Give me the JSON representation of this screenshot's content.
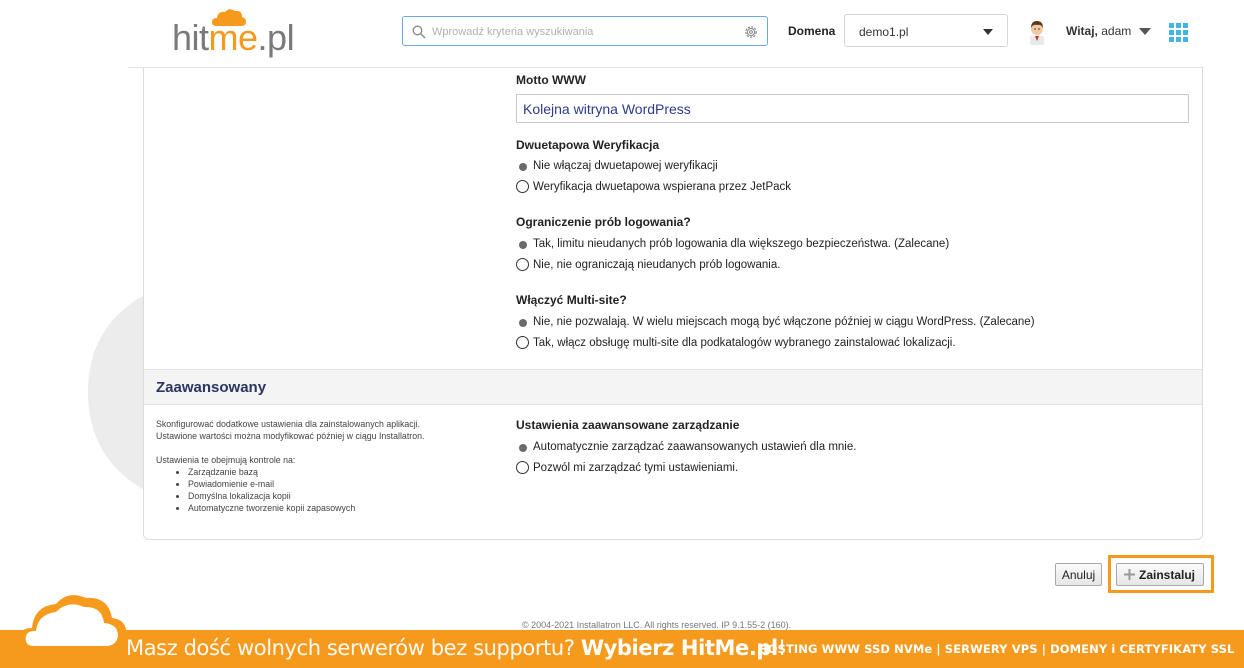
{
  "header": {
    "logo": {
      "part1": "hit",
      "part2": "me",
      "part3": ".pl"
    },
    "search": {
      "placeholder": "Wprowadź kryteria wyszukiwania"
    },
    "domain_label": "Domena",
    "domain_value": "demo1.pl",
    "greeting_bold": "Witaj,",
    "greeting_user": "adam"
  },
  "form": {
    "motto_title": "Motto WWW",
    "motto_value": "Kolejna witryna WordPress",
    "twofa": {
      "title": "Dwuetapowa Weryfikacja",
      "options": [
        "Nie włączaj dwuetapowej weryfikacji",
        "Weryfikacja dwuetapowa wspierana przez JetPack"
      ],
      "selected": 0
    },
    "login_limit": {
      "title": "Ograniczenie prób logowania?",
      "options": [
        "Tak, limitu nieudanych prób logowania dla większego bezpieczeństwa. (Zalecane)",
        "Nie, nie ograniczają nieudanych prób logowania."
      ],
      "selected": 0
    },
    "multisite": {
      "title": "Włączyć Multi-site?",
      "options": [
        "Nie, nie pozwalają. W wielu miejscach mogą być włączone później w ciągu WordPress. (Zalecane)",
        "Tak, włącz obsługę multi-site dla podkatalogów wybranego zainstalować lokalizacji."
      ],
      "selected": 0
    }
  },
  "advanced": {
    "section_title": "Zaawansowany",
    "desc_line1": "Skonfigurować dodatkowe ustawienia dla zainstalowanych aplikacji.",
    "desc_line2": "Ustawione wartości można modyfikować później w ciągu Installatron.",
    "desc_line3": "Ustawienia te obejmują kontrole na:",
    "desc_items": [
      "Zarządzanie bazą",
      "Powiadomienie e-mail",
      "Domyślna lokalizacja kopii",
      "Automatyczne tworzenie kopii zapasowych"
    ],
    "mgmt_title": "Ustawienia zaawansowane zarządzanie",
    "mgmt_options": [
      "Automatycznie zarządzać zaawansowanych ustawień dla mnie.",
      "Pozwól mi zarządzać tymi ustawieniami."
    ],
    "mgmt_selected": 0
  },
  "buttons": {
    "cancel": "Anuluj",
    "install": "Zainstaluj"
  },
  "footer": {
    "copyright": "© 2004-2021 Installatron LLC. All rights reserved. IP 9.1.55-2 (160)."
  },
  "banner": {
    "text_light": "Masz dość wolnych serwerów bez supportu?",
    "text_bold": "Wybierz HitMe.pl",
    "text_end": "!",
    "right": "HOSTING WWW SSD NVMe | SERWERY VPS | DOMENY i CERTYFIKATY SSL"
  },
  "colors": {
    "brand_orange": "#f59a1d",
    "search_border": "#6aa8e6",
    "section_title": "#2a3560",
    "input_text": "#2d3a8c"
  },
  "icons": [
    "search-icon",
    "gear-icon",
    "avatar",
    "apps-grid-icon",
    "plus-icon",
    "cloud-logo"
  ]
}
